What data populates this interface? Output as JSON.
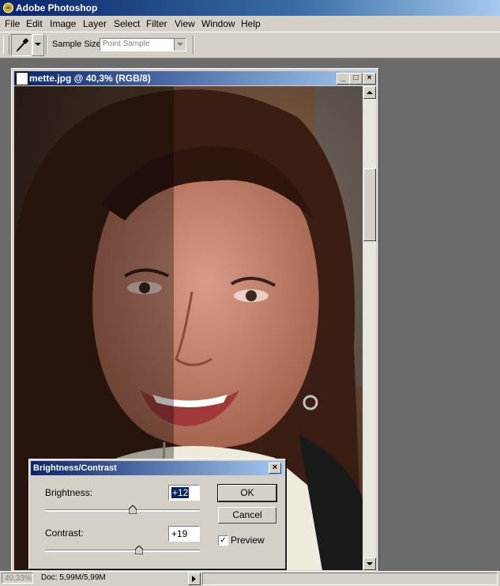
{
  "app": {
    "title": "Adobe Photoshop"
  },
  "menu": [
    "File",
    "Edit",
    "Image",
    "Layer",
    "Select",
    "Filter",
    "View",
    "Window",
    "Help"
  ],
  "options_bar": {
    "tool_icon": "eyedropper-icon",
    "sample_size_label": "Sample Size:",
    "sample_size_value": "Point Sample"
  },
  "document": {
    "title": "mette.jpg @ 40,3% (RGB/8)",
    "buttons": {
      "minimize": "_",
      "maximize": "□",
      "close": "×"
    }
  },
  "dialog": {
    "title": "Brightness/Contrast",
    "close": "×",
    "brightness_label": "Brightness:",
    "brightness_value": "+12",
    "contrast_label": "Contrast:",
    "contrast_value": "+19",
    "ok": "OK",
    "cancel": "Cancel",
    "preview_label": "Preview",
    "preview_checked": "✓"
  },
  "status": {
    "zoom": "40,33%",
    "doc_info": "Doc: 5,99M/5,99M"
  }
}
